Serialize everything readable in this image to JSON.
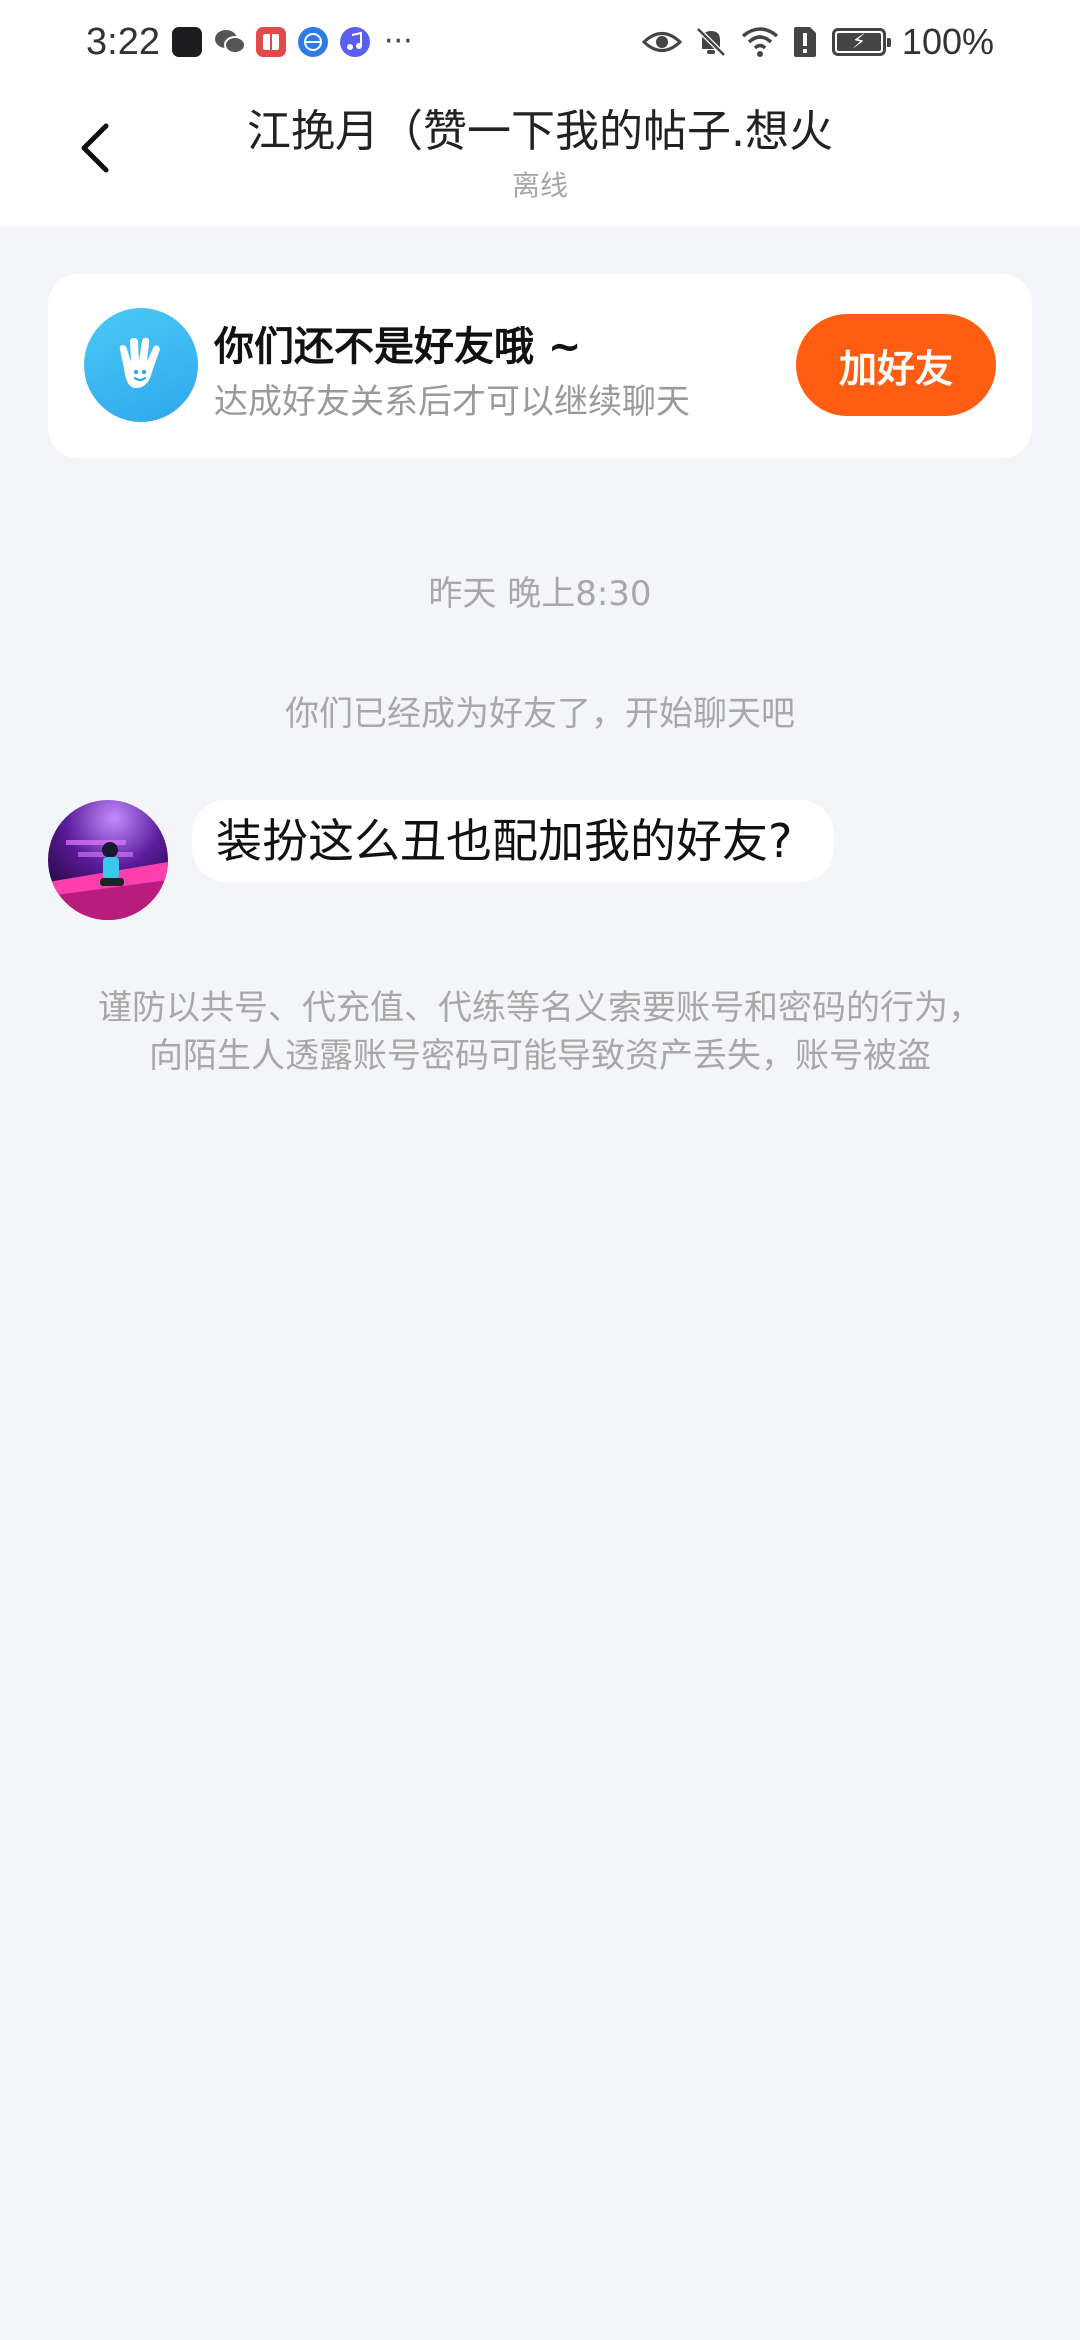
{
  "status_bar": {
    "time": "3:22",
    "notification_icons": [
      "app-icon",
      "wechat-icon",
      "book-icon",
      "browser-icon",
      "music-icon"
    ],
    "more": "···",
    "battery_level": 1.0,
    "battery_text": "100%"
  },
  "header": {
    "title": "江挽月（赞一下我的帖子.想火",
    "subtitle": "离线"
  },
  "friend_card": {
    "title": "你们还不是好友哦 ~",
    "subtitle": "达成好友关系后才可以继续聊天",
    "button_label": "加好友",
    "accent_color": "#ff5e12"
  },
  "chat": {
    "timestamp": "昨天 晚上8:30",
    "system_note": "你们已经成为好友了，开始聊天吧",
    "messages": [
      {
        "text": "装扮这么丑也配加我的好友?"
      }
    ]
  },
  "warning": {
    "text": "谨防以共号、代充值、代练等名义索要账号和密码的行为，向陌生人透露账号密码可能导致资产丢失，账号被盗"
  }
}
